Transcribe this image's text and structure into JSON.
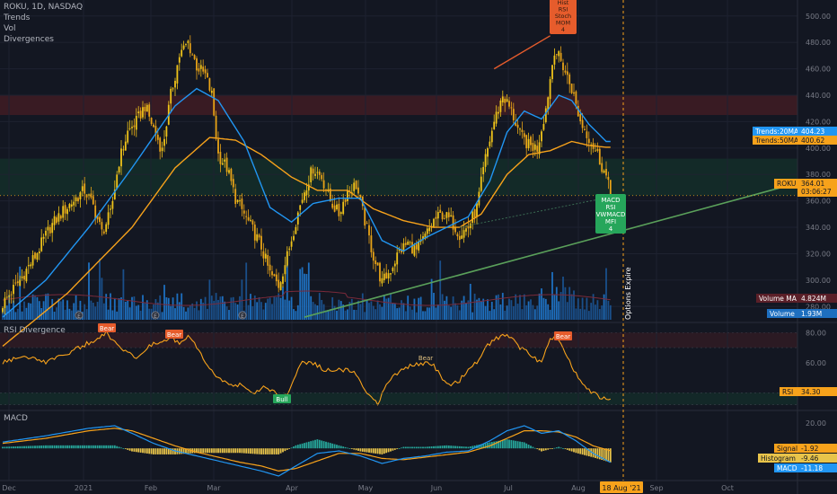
{
  "header": {
    "symbol_line": "ROKU, 1D, NASDAQ",
    "indicators": [
      "Trends",
      "Vol",
      "Divergences"
    ],
    "rsi_title": "RSI Divergence",
    "macd_title": "MACD"
  },
  "colors": {
    "bg": "#131722",
    "up": "#f0c419",
    "down": "#e8a317",
    "ma20": "#2196f3",
    "ma50": "#f7a21b",
    "vol_up": "#1e6fbf",
    "vol_down": "#1a4f8a",
    "rsi": "#f7a21b",
    "macd": "#2196f3",
    "signal": "#f7a21b",
    "bear": "#e65c2c",
    "bull": "#26a65b",
    "trendline": "#5aa05a",
    "red_zone": "#5a1f24",
    "green_zone": "#143a2e"
  },
  "price_axis": [
    "500.00",
    "480.00",
    "460.00",
    "440.00",
    "420.00",
    "400.00",
    "380.00",
    "360.00",
    "340.00",
    "320.00",
    "300.00",
    "280.00"
  ],
  "rsi_axis": [
    "80.00",
    "60.00",
    "40.00"
  ],
  "macd_axis": [
    "20.00"
  ],
  "time_axis": [
    "Dec",
    "2021",
    "Feb",
    "Mar",
    "Apr",
    "May",
    "Jun",
    "Jul",
    "Aug",
    "18 Aug '21",
    "Sep",
    "Oct"
  ],
  "badges": {
    "ma20": {
      "label": "Trends:20MA",
      "value": "404.23"
    },
    "ma50": {
      "label": "Trends:50MA",
      "value": "400.62"
    },
    "roku": {
      "label": "ROKU",
      "value": "364.01",
      "timer": "03:06:27"
    },
    "volume_ma": {
      "label": "Volume MA",
      "value": "4.824M"
    },
    "volume": {
      "label": "Volume",
      "value": "1.93M"
    },
    "rsi": {
      "label": "RSI",
      "value": "34.30"
    },
    "signal": {
      "label": "Signal",
      "value": "-1.92"
    },
    "histogram": {
      "label": "Histogram",
      "value": "-9.46"
    },
    "macd": {
      "label": "MACD",
      "value": "-11.18"
    }
  },
  "annotations": {
    "top_bear": [
      "Hist",
      "RSI",
      "Stoch",
      "MOM",
      "4"
    ],
    "bottom_bull": [
      "MACD",
      "RSI",
      "VWMACD",
      "MFI",
      "4"
    ],
    "options_expire": "Options Expire",
    "rsi_labels": [
      {
        "text": "Bear",
        "type": "bear"
      },
      {
        "text": "Bear",
        "type": "bear"
      },
      {
        "text": "Bull",
        "type": "bull"
      },
      {
        "text": "Bear",
        "type": "bear-plain"
      },
      {
        "text": "Bear",
        "type": "bear"
      }
    ],
    "earnings_marker": "E"
  },
  "chart_data": [
    {
      "type": "candlestick",
      "title": "ROKU, 1D, NASDAQ",
      "ylim": [
        270,
        508
      ],
      "x_labels": [
        "Dec",
        "2021",
        "Feb",
        "Mar",
        "Apr",
        "May",
        "Jun",
        "Jul",
        "Aug",
        "Sep",
        "Oct"
      ],
      "close_anchors": [
        [
          0,
          282
        ],
        [
          8,
          300
        ],
        [
          15,
          318
        ],
        [
          22,
          340
        ],
        [
          28,
          352
        ],
        [
          34,
          362
        ],
        [
          38,
          368
        ],
        [
          42,
          356
        ],
        [
          46,
          336
        ],
        [
          50,
          350
        ],
        [
          54,
          390
        ],
        [
          58,
          412
        ],
        [
          62,
          420
        ],
        [
          66,
          432
        ],
        [
          70,
          415
        ],
        [
          74,
          398
        ],
        [
          78,
          440
        ],
        [
          82,
          470
        ],
        [
          86,
          480
        ],
        [
          90,
          462
        ],
        [
          94,
          455
        ],
        [
          97,
          440
        ],
        [
          100,
          395
        ],
        [
          104,
          385
        ],
        [
          108,
          362
        ],
        [
          112,
          350
        ],
        [
          116,
          338
        ],
        [
          120,
          325
        ],
        [
          124,
          305
        ],
        [
          128,
          296
        ],
        [
          132,
          318
        ],
        [
          136,
          345
        ],
        [
          140,
          368
        ],
        [
          144,
          385
        ],
        [
          148,
          378
        ],
        [
          152,
          360
        ],
        [
          156,
          350
        ],
        [
          160,
          368
        ],
        [
          164,
          372
        ],
        [
          168,
          345
        ],
        [
          172,
          318
        ],
        [
          176,
          298
        ],
        [
          180,
          308
        ],
        [
          184,
          322
        ],
        [
          188,
          328
        ],
        [
          192,
          322
        ],
        [
          196,
          333
        ],
        [
          200,
          345
        ],
        [
          204,
          350
        ],
        [
          208,
          345
        ],
        [
          212,
          335
        ],
        [
          216,
          340
        ],
        [
          220,
          355
        ],
        [
          224,
          392
        ],
        [
          228,
          420
        ],
        [
          232,
          440
        ],
        [
          236,
          428
        ],
        [
          240,
          410
        ],
        [
          244,
          402
        ],
        [
          248,
          400
        ],
        [
          252,
          430
        ],
        [
          256,
          475
        ],
        [
          260,
          462
        ],
        [
          264,
          445
        ],
        [
          268,
          420
        ],
        [
          272,
          408
        ],
        [
          276,
          395
        ],
        [
          280,
          378
        ],
        [
          282,
          364.01
        ]
      ],
      "ma20_anchors": [
        [
          0,
          272
        ],
        [
          20,
          300
        ],
        [
          40,
          340
        ],
        [
          60,
          385
        ],
        [
          80,
          432
        ],
        [
          90,
          445
        ],
        [
          100,
          436
        ],
        [
          112,
          405
        ],
        [
          124,
          355
        ],
        [
          134,
          344
        ],
        [
          144,
          358
        ],
        [
          156,
          362
        ],
        [
          166,
          362
        ],
        [
          176,
          330
        ],
        [
          186,
          322
        ],
        [
          196,
          332
        ],
        [
          206,
          340
        ],
        [
          216,
          348
        ],
        [
          226,
          375
        ],
        [
          234,
          412
        ],
        [
          242,
          428
        ],
        [
          250,
          422
        ],
        [
          258,
          440
        ],
        [
          264,
          436
        ],
        [
          272,
          418
        ],
        [
          280,
          405
        ]
      ],
      "ma50_anchors": [
        [
          0,
          250
        ],
        [
          30,
          290
        ],
        [
          60,
          340
        ],
        [
          80,
          385
        ],
        [
          96,
          408
        ],
        [
          108,
          406
        ],
        [
          120,
          395
        ],
        [
          134,
          378
        ],
        [
          146,
          368
        ],
        [
          160,
          368
        ],
        [
          172,
          354
        ],
        [
          186,
          345
        ],
        [
          200,
          340
        ],
        [
          212,
          340
        ],
        [
          222,
          350
        ],
        [
          234,
          380
        ],
        [
          244,
          395
        ],
        [
          254,
          398
        ],
        [
          264,
          405
        ],
        [
          272,
          402
        ],
        [
          280,
          400.62
        ]
      ],
      "trendline": [
        [
          140,
          272
        ],
        [
          282,
          335
        ]
      ],
      "series": [
        {
          "name": "Trends:20MA",
          "last": 404.23
        },
        {
          "name": "Trends:50MA",
          "last": 400.62
        }
      ],
      "current_price": 364.01
    },
    {
      "type": "bar",
      "title": "Vol",
      "last": "1.93M",
      "ma_last": "4.824M"
    },
    {
      "type": "line",
      "title": "RSI Divergence",
      "ylim": [
        30,
        85
      ],
      "rsi_anchors": [
        [
          0,
          60
        ],
        [
          10,
          65
        ],
        [
          20,
          60
        ],
        [
          30,
          66
        ],
        [
          38,
          72
        ],
        [
          44,
          76
        ],
        [
          48,
          80
        ],
        [
          54,
          70
        ],
        [
          58,
          68
        ],
        [
          62,
          63
        ],
        [
          68,
          72
        ],
        [
          74,
          73
        ],
        [
          78,
          78
        ],
        [
          82,
          72
        ],
        [
          86,
          78
        ],
        [
          90,
          70
        ],
        [
          94,
          60
        ],
        [
          98,
          52
        ],
        [
          104,
          46
        ],
        [
          110,
          45
        ],
        [
          116,
          40
        ],
        [
          122,
          44
        ],
        [
          126,
          40
        ],
        [
          130,
          35
        ],
        [
          134,
          45
        ],
        [
          138,
          60
        ],
        [
          144,
          60
        ],
        [
          150,
          55
        ],
        [
          156,
          55
        ],
        [
          162,
          55
        ],
        [
          166,
          48
        ],
        [
          170,
          38
        ],
        [
          174,
          33
        ],
        [
          178,
          45
        ],
        [
          184,
          55
        ],
        [
          190,
          58
        ],
        [
          196,
          60
        ],
        [
          200,
          58
        ],
        [
          204,
          50
        ],
        [
          208,
          45
        ],
        [
          212,
          48
        ],
        [
          216,
          56
        ],
        [
          220,
          60
        ],
        [
          224,
          70
        ],
        [
          228,
          76
        ],
        [
          232,
          78
        ],
        [
          236,
          77
        ],
        [
          240,
          70
        ],
        [
          246,
          64
        ],
        [
          250,
          60
        ],
        [
          254,
          75
        ],
        [
          256,
          78
        ],
        [
          260,
          70
        ],
        [
          264,
          58
        ],
        [
          270,
          44
        ],
        [
          276,
          38
        ],
        [
          282,
          34.3
        ]
      ],
      "last": 34.3
    },
    {
      "type": "line",
      "title": "MACD",
      "ylim": [
        -22,
        28
      ],
      "macd_anchors": [
        [
          0,
          5
        ],
        [
          20,
          10
        ],
        [
          40,
          16
        ],
        [
          52,
          18
        ],
        [
          60,
          12
        ],
        [
          70,
          4
        ],
        [
          80,
          -2
        ],
        [
          90,
          -6
        ],
        [
          100,
          -10
        ],
        [
          110,
          -14
        ],
        [
          120,
          -18
        ],
        [
          128,
          -22
        ],
        [
          136,
          -14
        ],
        [
          146,
          -4
        ],
        [
          156,
          -2
        ],
        [
          166,
          -6
        ],
        [
          176,
          -12
        ],
        [
          186,
          -8
        ],
        [
          196,
          -6
        ],
        [
          206,
          -3
        ],
        [
          216,
          -2
        ],
        [
          226,
          6
        ],
        [
          234,
          14
        ],
        [
          242,
          18
        ],
        [
          250,
          12
        ],
        [
          258,
          14
        ],
        [
          266,
          6
        ],
        [
          274,
          -4
        ],
        [
          282,
          -11.18
        ]
      ],
      "signal_anchors": [
        [
          0,
          4
        ],
        [
          20,
          8
        ],
        [
          40,
          14
        ],
        [
          52,
          16
        ],
        [
          60,
          14
        ],
        [
          70,
          8
        ],
        [
          80,
          2
        ],
        [
          90,
          -3
        ],
        [
          100,
          -7
        ],
        [
          110,
          -11
        ],
        [
          120,
          -14
        ],
        [
          128,
          -18
        ],
        [
          136,
          -16
        ],
        [
          146,
          -10
        ],
        [
          156,
          -4
        ],
        [
          166,
          -4
        ],
        [
          176,
          -8
        ],
        [
          186,
          -9
        ],
        [
          196,
          -7
        ],
        [
          206,
          -5
        ],
        [
          216,
          -3
        ],
        [
          226,
          2
        ],
        [
          234,
          8
        ],
        [
          242,
          14
        ],
        [
          250,
          14
        ],
        [
          258,
          13
        ],
        [
          266,
          9
        ],
        [
          274,
          2
        ],
        [
          282,
          -1.92
        ]
      ],
      "series": [
        {
          "name": "MACD",
          "last": -11.18
        },
        {
          "name": "Signal",
          "last": -1.92
        },
        {
          "name": "Histogram",
          "last": -9.46
        }
      ]
    }
  ]
}
